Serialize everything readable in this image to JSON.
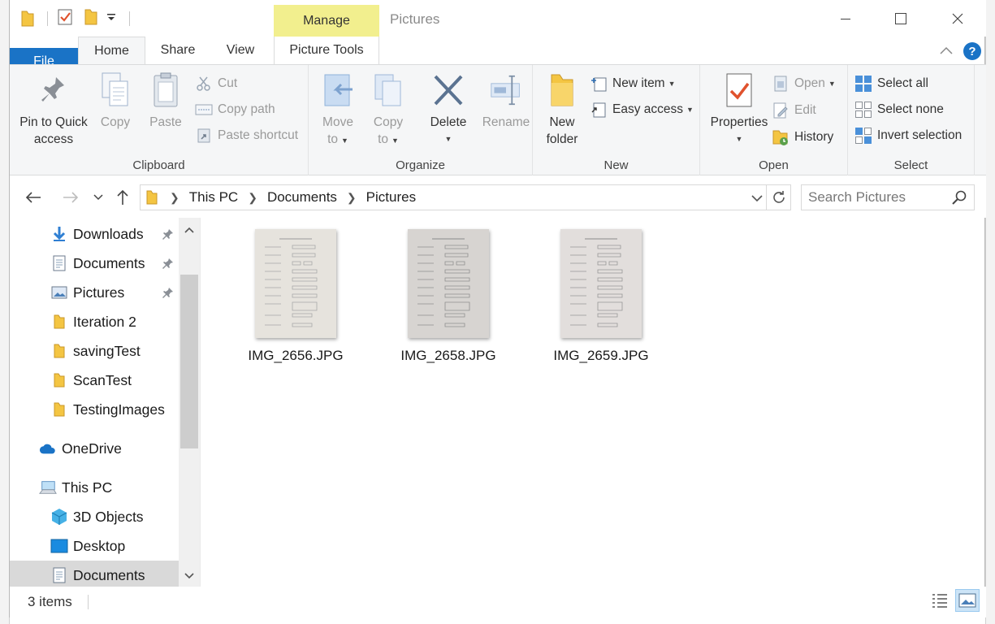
{
  "window": {
    "title": "Pictures",
    "context_tab": "Manage",
    "minimize_glyph": "—",
    "maximize_glyph": "☐",
    "close_glyph": "✕"
  },
  "tabs": {
    "file": "File",
    "home": "Home",
    "share": "Share",
    "view": "View",
    "picture_tools": "Picture Tools"
  },
  "ribbon": {
    "clipboard": {
      "label": "Clipboard",
      "pin_line1": "Pin to Quick",
      "pin_line2": "access",
      "copy": "Copy",
      "paste": "Paste",
      "cut": "Cut",
      "copy_path": "Copy path",
      "paste_shortcut": "Paste shortcut"
    },
    "organize": {
      "label": "Organize",
      "move_line1": "Move",
      "move_line2": "to",
      "copy_line1": "Copy",
      "copy_line2": "to",
      "delete": "Delete",
      "rename": "Rename"
    },
    "new": {
      "label": "New",
      "folder_line1": "New",
      "folder_line2": "folder",
      "new_item": "New item",
      "easy_access": "Easy access"
    },
    "open": {
      "label": "Open",
      "properties": "Properties",
      "open": "Open",
      "edit": "Edit",
      "history": "History"
    },
    "select": {
      "label": "Select",
      "select_all": "Select all",
      "select_none": "Select none",
      "invert": "Invert selection"
    }
  },
  "address": {
    "crumbs": [
      "This PC",
      "Documents",
      "Pictures"
    ],
    "search_placeholder": "Search Pictures"
  },
  "navpane": {
    "quick_access": [
      {
        "label": "Downloads",
        "icon": "download-arrow-icon",
        "pinned": true
      },
      {
        "label": "Documents",
        "icon": "document-icon",
        "pinned": true
      },
      {
        "label": "Pictures",
        "icon": "pictures-icon",
        "pinned": true
      },
      {
        "label": "Iteration 2",
        "icon": "folder-icon",
        "pinned": false
      },
      {
        "label": "savingTest",
        "icon": "folder-icon",
        "pinned": false
      },
      {
        "label": "ScanTest",
        "icon": "folder-icon",
        "pinned": false
      },
      {
        "label": "TestingImages",
        "icon": "folder-icon",
        "pinned": false
      }
    ],
    "onedrive": "OneDrive",
    "this_pc": "This PC",
    "pc_items": [
      "3D Objects",
      "Desktop",
      "Documents"
    ]
  },
  "files": [
    {
      "name": "IMG_2656.JPG"
    },
    {
      "name": "IMG_2658.JPG"
    },
    {
      "name": "IMG_2659.JPG"
    }
  ],
  "status": {
    "count": "3 items"
  },
  "colors": {
    "accent": "#1a73c6",
    "manage_tab": "#f2ef8e",
    "folder": "#f4c542"
  }
}
